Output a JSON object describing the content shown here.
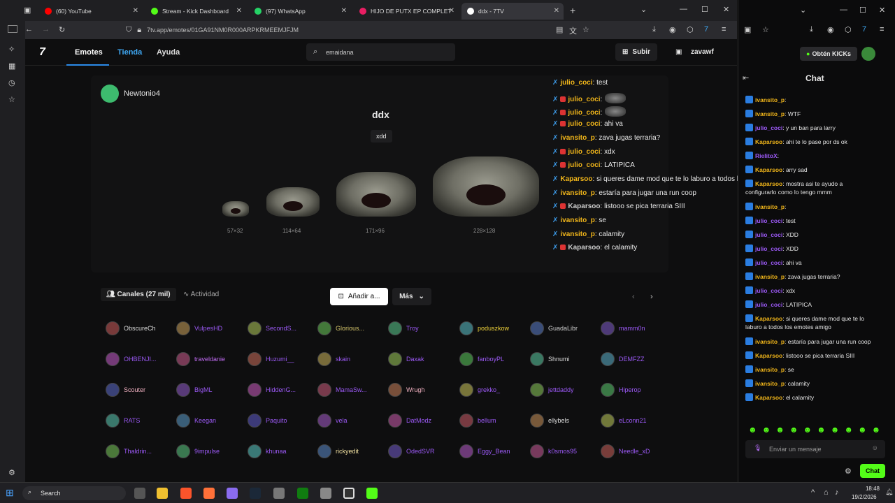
{
  "browser": {
    "tabs": [
      {
        "title": "(60) YouTube",
        "color": "#ff0000"
      },
      {
        "title": "Stream - Kick Dashboard",
        "color": "#53fc18"
      },
      {
        "title": "(97) WhatsApp",
        "color": "#25d366"
      },
      {
        "title": "HIJO DE PUTX EP COMPLET",
        "color": "#e91e63"
      },
      {
        "title": "ddx - 7TV",
        "color": "#ffffff"
      }
    ],
    "url": "7tv.app/emotes/01GA91NM0R000ARPKRMEEMJFJM"
  },
  "nav": {
    "links": [
      "Emotes",
      "Tienda",
      "Ayuda"
    ],
    "search_value": "emaidana",
    "subir": "Subir",
    "user": "zavawf"
  },
  "emote": {
    "uploader": "Newtonio4",
    "name": "ddx",
    "tag": "xdd",
    "sizes": [
      "57×32",
      "114×64",
      "171×96",
      "228×128"
    ],
    "add_button": "Añadir a...",
    "more_button": "Más"
  },
  "overlay_chat": [
    {
      "user": "julio_coci",
      "color": "#f0b51a",
      "text": ": test",
      "badge": false
    },
    {
      "user": "julio_coci",
      "color": "#f0b51a",
      "text": ":",
      "badge": true,
      "emote": true
    },
    {
      "user": "julio_coci",
      "color": "#f0b51a",
      "text": ":",
      "badge": true,
      "emote": true
    },
    {
      "user": "julio_coci",
      "color": "#f0b51a",
      "text": ": ahi va",
      "badge": true
    },
    {
      "user": "ivansito_p",
      "color": "#f0b51a",
      "text": ": zava jugas terraria?",
      "badge": false
    },
    {
      "user": "julio_coci",
      "color": "#f0b51a",
      "text": ": xdx",
      "badge": true
    },
    {
      "user": "julio_coci",
      "color": "#f0b51a",
      "text": ": LATIPICA",
      "badge": true
    },
    {
      "user": "Kaparsoo",
      "color": "#f0b51a",
      "text": ": si queres dame mod que te lo laburo a todos los emotes amigo",
      "badge": false
    },
    {
      "user": "ivansito_p",
      "color": "#f0b51a",
      "text": ": estaría para jugar una run coop",
      "badge": false
    },
    {
      "user": "Kaparsoo",
      "color": "#cccccc",
      "text": ": listooo se pica terraria SIII",
      "badge": true
    },
    {
      "user": "ivansito_p",
      "color": "#f0b51a",
      "text": ": se",
      "badge": false
    },
    {
      "user": "ivansito_p",
      "color": "#f0b51a",
      "text": ": calamity",
      "badge": false
    },
    {
      "user": "Kaparsoo",
      "color": "#cccccc",
      "text": ": el calamity",
      "badge": true
    }
  ],
  "channels_tab": "Canales (27 mil)",
  "activity_tab": "Actividad",
  "channels": [
    [
      "ObscureCh",
      "VulpesHD",
      "SecondS...",
      "Glorious...",
      "Troy",
      "poduszkow",
      "GuadaLibr",
      "mamm0n"
    ],
    [
      "OHBENJI...",
      "traveldanie",
      "Huzumi__",
      "skain",
      "Daxak",
      "fanboyPL",
      "Shnumi",
      "DEMFZZ"
    ],
    [
      "Scouter",
      "BigML",
      "HiddenG...",
      "MamaSw...",
      "Wrugh",
      "grekko_",
      "jettdaddy",
      "Hiperop"
    ],
    [
      "RATS",
      "Keegan",
      "Paquito",
      "vela",
      "DatModz",
      "bellum",
      "ellybels",
      "eLconn21"
    ],
    [
      "Thaldrin...",
      "9impulse",
      "khunaa",
      "rickyedit",
      "OdedSVR",
      "Eggy_Bean",
      "k0smos95",
      "Needle_xD"
    ]
  ],
  "channel_colors": [
    [
      "#dddddd",
      "#9b59f5",
      "#9b59f5",
      "#d4c46a",
      "#9b59f5",
      "#f0d33a",
      "#cccccc",
      "#9b59f5"
    ],
    [
      "#9b59f5",
      "#c06bf2",
      "#9b59f5",
      "#9b59f5",
      "#9b59f5",
      "#9b59f5",
      "#dddddd",
      "#9b59f5"
    ],
    [
      "#f0b0c0",
      "#9b59f5",
      "#9b59f5",
      "#9b59f5",
      "#f0b0c0",
      "#9b59f5",
      "#9b59f5",
      "#9b59f5"
    ],
    [
      "#9b59f5",
      "#9b59f5",
      "#9b59f5",
      "#9b59f5",
      "#9b59f5",
      "#9b59f5",
      "#dddddd",
      "#9b59f5"
    ],
    [
      "#9b59f5",
      "#9b59f5",
      "#9b59f5",
      "#f0e0a0",
      "#9b59f5",
      "#9b59f5",
      "#9b59f5",
      "#9b59f5"
    ]
  ],
  "kick": {
    "get_kicks": "Obtén KICKs",
    "chat_title": "Chat",
    "messages": [
      {
        "user": "ivansito_p",
        "color": "#f0b51a",
        "text": ":"
      },
      {
        "user": "ivansito_p",
        "color": "#f0b51a",
        "text": ": WTF"
      },
      {
        "user": "julio_coci",
        "color": "#9b59f5",
        "text": ": y un ban para larry"
      },
      {
        "user": "Kaparsoo",
        "color": "#f0b51a",
        "text": ": ahi te lo pase por ds ok"
      },
      {
        "user": "RielitoX",
        "color": "#9b59f5",
        "text": ":"
      },
      {
        "user": "Kaparsoo",
        "color": "#f0b51a",
        "text": ": arry sad"
      },
      {
        "user": "Kaparsoo",
        "color": "#f0b51a",
        "text": ": mostra asi te ayudo a"
      },
      {
        "user": "",
        "color": "#e6e6e6",
        "text": "configurarlo como lo tengo mmm"
      },
      {
        "user": "ivansito_p",
        "color": "#f0b51a",
        "text": ":"
      },
      {
        "user": "julio_coci",
        "color": "#9b59f5",
        "text": ": test"
      },
      {
        "user": "julio_coci",
        "color": "#9b59f5",
        "text": ": XDD"
      },
      {
        "user": "julio_coci",
        "color": "#9b59f5",
        "text": ": XDD"
      },
      {
        "user": "julio_coci",
        "color": "#9b59f5",
        "text": ": ahi va"
      },
      {
        "user": "ivansito_p",
        "color": "#f0b51a",
        "text": ": zava jugas terraria?"
      },
      {
        "user": "julio_coci",
        "color": "#9b59f5",
        "text": ": xdx"
      },
      {
        "user": "julio_coci",
        "color": "#9b59f5",
        "text": ": LATIPICA"
      },
      {
        "user": "Kaparsoo",
        "color": "#f0b51a",
        "text": ": si queres dame mod que te lo"
      },
      {
        "user": "",
        "color": "#e6e6e6",
        "text": "laburo a todos los emotes amigo"
      },
      {
        "user": "ivansito_p",
        "color": "#f0b51a",
        "text": ": estaría para jugar una run coop"
      },
      {
        "user": "Kaparsoo",
        "color": "#f0b51a",
        "text": ": listooo se pica terraria SIII"
      },
      {
        "user": "ivansito_p",
        "color": "#f0b51a",
        "text": ": se"
      },
      {
        "user": "ivansito_p",
        "color": "#f0b51a",
        "text": ": calamity"
      },
      {
        "user": "Kaparsoo",
        "color": "#f0b51a",
        "text": ": el calamity"
      }
    ],
    "input_placeholder": "Enviar un mensaje",
    "send_button": "Chat"
  },
  "taskbar": {
    "search": "Search",
    "time": "18:48",
    "date": "19/2/2026"
  }
}
